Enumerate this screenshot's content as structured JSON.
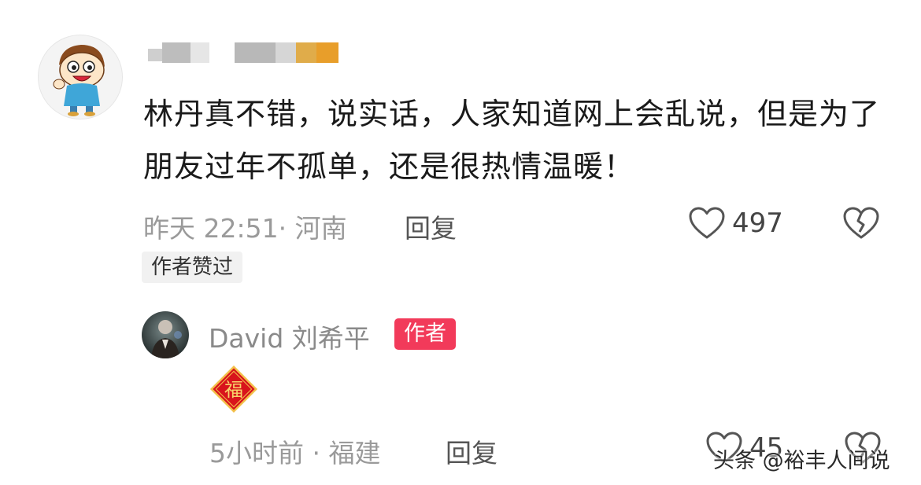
{
  "comment": {
    "text": "林丹真不错，说实话，人家知道网上会乱说，但是为了朋友过年不孤单，还是很热情温暖！",
    "time_location": "昨天 22:51· 河南",
    "reply_label": "回复",
    "like_count": "497",
    "author_liked_badge": "作者赞过"
  },
  "reply": {
    "user_name": "David 刘希平",
    "author_tag": "作者",
    "sticker_char": "福",
    "time_location": "5小时前 · 福建",
    "reply_label": "回复",
    "like_count": "45"
  },
  "watermark": "头条 @裕丰人间说",
  "icons": {
    "like": "heart-outline-icon",
    "dislike": "broken-heart-icon",
    "sticker": "fu-diamond-icon"
  },
  "colors": {
    "author_tag_bg": "#f23a5a",
    "muted_text": "#9a9a9a",
    "fu_red": "#d8141c",
    "fu_gold": "#f3c04a"
  }
}
